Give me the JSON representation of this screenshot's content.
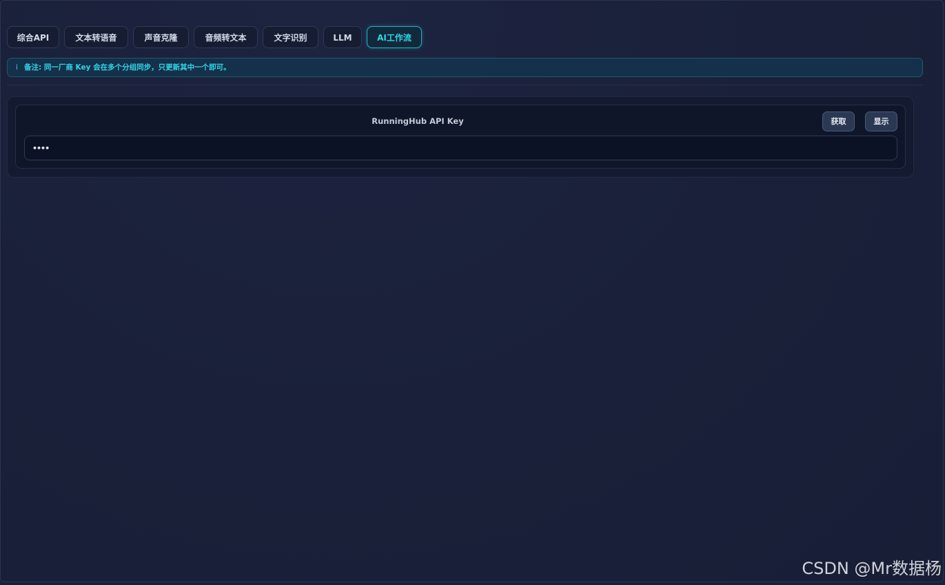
{
  "tabs": [
    {
      "label": "综合API",
      "active": false
    },
    {
      "label": "文本转语音",
      "active": false
    },
    {
      "label": "声音克隆",
      "active": false
    },
    {
      "label": "音频转文本",
      "active": false
    },
    {
      "label": "文字识别",
      "active": false
    },
    {
      "label": "LLM",
      "active": false
    },
    {
      "label": "AI工作流",
      "active": true
    }
  ],
  "note": {
    "icon": "i",
    "text": "备注: 同一厂商 Key 会在多个分组同步，只更新其中一个即可。"
  },
  "api_key_section": {
    "label": "RunningHub API Key",
    "get_button": "获取",
    "show_button": "显示",
    "input_value": "••••"
  },
  "watermark": "CSDN @Mr数据杨",
  "colors": {
    "accent": "#2ed8e8",
    "background": "#1a2038",
    "button": "#2b3854"
  }
}
